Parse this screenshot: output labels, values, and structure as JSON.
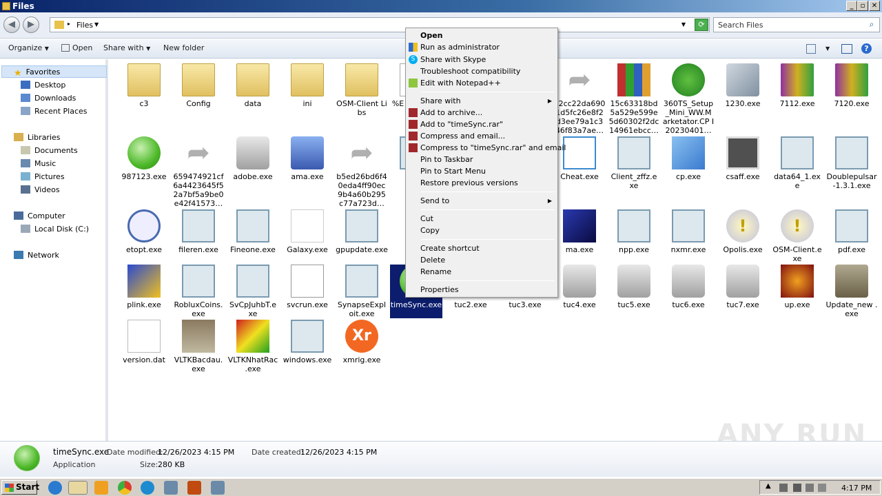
{
  "window": {
    "title": "Files"
  },
  "address": {
    "path": "Files",
    "search_placeholder": "Search Files"
  },
  "toolbar": {
    "organize": "Organize",
    "open": "Open",
    "share_with": "Share with",
    "new_folder": "New folder"
  },
  "nav": {
    "favorites": "Favorites",
    "desktop": "Desktop",
    "downloads": "Downloads",
    "recent": "Recent Places",
    "libraries": "Libraries",
    "documents": "Documents",
    "music": "Music",
    "pictures": "Pictures",
    "videos": "Videos",
    "computer": "Computer",
    "localdisk": "Local Disk (C:)",
    "network": "Network"
  },
  "files": [
    {
      "name": "c3",
      "icon": "folder"
    },
    {
      "name": "Config",
      "icon": "folder"
    },
    {
      "name": "data",
      "icon": "folder"
    },
    {
      "name": "ini",
      "icon": "folder"
    },
    {
      "name": "OSM-Client Libs",
      "icon": "folder"
    },
    {
      "name": "%E\n1%\nA8\n%",
      "icon": "doc"
    },
    {
      "name": "12cc22da690 1d5fc26e8f2 d3ee79a1c3 46f83a7ae…",
      "icon": "shortcut"
    },
    {
      "name": "15c63318bd 5a529e599e 5d60302f2dc 14961ebcc…",
      "icon": "books"
    },
    {
      "name": "360TS_Setup _Mini_WW.M arketator.CP I20230401…",
      "icon": "shield"
    },
    {
      "name": "1230.exe",
      "icon": "cd"
    },
    {
      "name": "7112.exe",
      "icon": "rar"
    },
    {
      "name": "7120.exe",
      "icon": "rar"
    },
    {
      "name": "987123.exe",
      "icon": "green"
    },
    {
      "name": "659474921cf 6a4423645f5 2a7bf5a9be0 e42f41573…",
      "icon": "shortcut"
    },
    {
      "name": "adobe.exe",
      "icon": "music"
    },
    {
      "name": "ama.exe",
      "icon": "pc"
    },
    {
      "name": "b5ed26bd6f4 0eda4ff90ec 9b4a60b295 c77a723d…",
      "icon": "shortcut"
    },
    {
      "name": "b…",
      "icon": "app"
    },
    {
      "name": "Cheat.exe",
      "icon": "download"
    },
    {
      "name": "Client_zffz.e xe",
      "icon": "app"
    },
    {
      "name": "cp.exe",
      "icon": "blue"
    },
    {
      "name": "csaff.exe",
      "icon": "gift"
    },
    {
      "name": "data64_1.ex e",
      "icon": "app"
    },
    {
      "name": "Doublepulsar -1.3.1.exe",
      "icon": "app"
    },
    {
      "name": "etopt.exe",
      "icon": "clock"
    },
    {
      "name": "fileren.exe",
      "icon": "app"
    },
    {
      "name": "Fineone.exe",
      "icon": "app"
    },
    {
      "name": "Galaxy.exe",
      "icon": "vs"
    },
    {
      "name": "gpupdate.exe",
      "icon": "app"
    },
    {
      "name": "ma.exe",
      "icon": "box"
    },
    {
      "name": "npp.exe",
      "icon": "app"
    },
    {
      "name": "nxmr.exe",
      "icon": "app"
    },
    {
      "name": "Opolis.exe",
      "icon": "excl"
    },
    {
      "name": "OSM-Client.e xe",
      "icon": "excl"
    },
    {
      "name": "pdf.exe",
      "icon": "app"
    },
    {
      "name": "plink.exe",
      "icon": "plink"
    },
    {
      "name": "RobluxCoins. exe",
      "icon": "app"
    },
    {
      "name": "SvCpJuhbT.e xe",
      "icon": "app"
    },
    {
      "name": "svcrun.exe",
      "icon": "house"
    },
    {
      "name": "SynapseExpl oit.exe",
      "icon": "app"
    },
    {
      "name": "timeSync.exe",
      "icon": "green"
    },
    {
      "name": "tuc2.exe",
      "icon": "music"
    },
    {
      "name": "tuc3.exe",
      "icon": "music"
    },
    {
      "name": "tuc4.exe",
      "icon": "music"
    },
    {
      "name": "tuc5.exe",
      "icon": "music"
    },
    {
      "name": "tuc6.exe",
      "icon": "music"
    },
    {
      "name": "tuc7.exe",
      "icon": "music"
    },
    {
      "name": "up.exe",
      "icon": "up"
    },
    {
      "name": "Update_new .exe",
      "icon": "update"
    },
    {
      "name": "version.dat",
      "icon": "blank"
    },
    {
      "name": "VLTKBacdau. exe",
      "icon": "knight"
    },
    {
      "name": "VLTKNhatRac .exe",
      "icon": "tetris"
    },
    {
      "name": "windows.exe",
      "icon": "app"
    },
    {
      "name": "xmrig.exe",
      "icon": "xmr"
    }
  ],
  "menu": {
    "open": "Open",
    "runadmin": "Run as administrator",
    "skype": "Share with Skype",
    "troubleshoot": "Troubleshoot compatibility",
    "notepad": "Edit with Notepad++",
    "sharewith": "Share with",
    "addarchive": "Add to archive...",
    "addrar": "Add to \"timeSync.rar\"",
    "compressemail": "Compress and email...",
    "compressrar": "Compress to \"timeSync.rar\" and email",
    "pintaskbar": "Pin to Taskbar",
    "pinstart": "Pin to Start Menu",
    "restore": "Restore previous versions",
    "sendto": "Send to",
    "cut": "Cut",
    "copy": "Copy",
    "shortcut": "Create shortcut",
    "delete": "Delete",
    "rename": "Rename",
    "properties": "Properties"
  },
  "details": {
    "name": "timeSync.exe",
    "type": "Application",
    "modified_label": "Date modified:",
    "modified": "12/26/2023 4:15 PM",
    "created_label": "Date created:",
    "created": "12/26/2023 4:15 PM",
    "size_label": "Size:",
    "size": "280 KB"
  },
  "taskbar": {
    "start": "Start",
    "time": "4:17 PM"
  },
  "watermark": "ANY RUN"
}
